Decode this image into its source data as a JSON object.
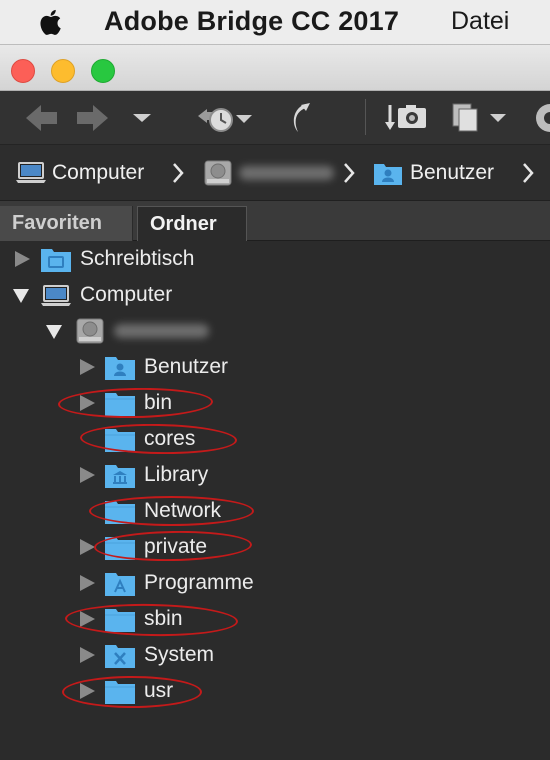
{
  "menubar": {
    "app_name": "Adobe Bridge CC 2017",
    "file_menu": "Datei"
  },
  "window": {
    "buttons": [
      "close",
      "minimize",
      "zoom"
    ]
  },
  "toolbar": {
    "icons": [
      "back-arrow-icon",
      "forward-arrow-icon",
      "chevron-down-icon",
      "recent-history-icon",
      "return-to-app-icon",
      "camera-import-icon",
      "copy-pages-icon",
      "chevron-down-icon",
      "sync-icon"
    ]
  },
  "pathbar": {
    "crumbs": [
      {
        "label": "Computer",
        "icon": "laptop-icon"
      },
      {
        "label": "",
        "icon": "hard-drive-icon",
        "redacted": true
      },
      {
        "label": "Benutzer",
        "icon": "users-folder-icon"
      }
    ]
  },
  "tabs": {
    "favorites": "Favoriten",
    "folders": "Ordner",
    "active": "Ordner"
  },
  "tree": {
    "items": [
      {
        "label": "Schreibtisch",
        "icon": "desktop-folder-icon",
        "level": 0,
        "state": "collapsed",
        "highlighted": false
      },
      {
        "label": "Computer",
        "icon": "laptop-icon",
        "level": 0,
        "state": "expanded",
        "highlighted": false
      },
      {
        "label": "",
        "icon": "hard-drive-icon",
        "level": 1,
        "state": "expanded",
        "highlighted": false,
        "redacted": true
      },
      {
        "label": "Benutzer",
        "icon": "users-folder-icon",
        "level": 2,
        "state": "collapsed",
        "highlighted": false
      },
      {
        "label": "bin",
        "icon": "folder-icon",
        "level": 2,
        "state": "collapsed",
        "highlighted": true
      },
      {
        "label": "cores",
        "icon": "folder-icon",
        "level": 2,
        "state": "none",
        "highlighted": true
      },
      {
        "label": "Library",
        "icon": "library-folder-icon",
        "level": 2,
        "state": "collapsed",
        "highlighted": false
      },
      {
        "label": "Network",
        "icon": "folder-icon",
        "level": 2,
        "state": "none",
        "highlighted": true
      },
      {
        "label": "private",
        "icon": "folder-icon",
        "level": 2,
        "state": "collapsed",
        "highlighted": true
      },
      {
        "label": "Programme",
        "icon": "applications-folder-icon",
        "level": 2,
        "state": "collapsed",
        "highlighted": false
      },
      {
        "label": "sbin",
        "icon": "folder-icon",
        "level": 2,
        "state": "collapsed",
        "highlighted": true
      },
      {
        "label": "System",
        "icon": "system-folder-icon",
        "level": 2,
        "state": "collapsed",
        "highlighted": false
      },
      {
        "label": "usr",
        "icon": "folder-icon",
        "level": 2,
        "state": "collapsed",
        "highlighted": true
      }
    ]
  },
  "colors": {
    "annotation_ring": "#c41a1a",
    "folder_blue": "#5ab4ee",
    "panel_bg": "#2b2b2b"
  }
}
